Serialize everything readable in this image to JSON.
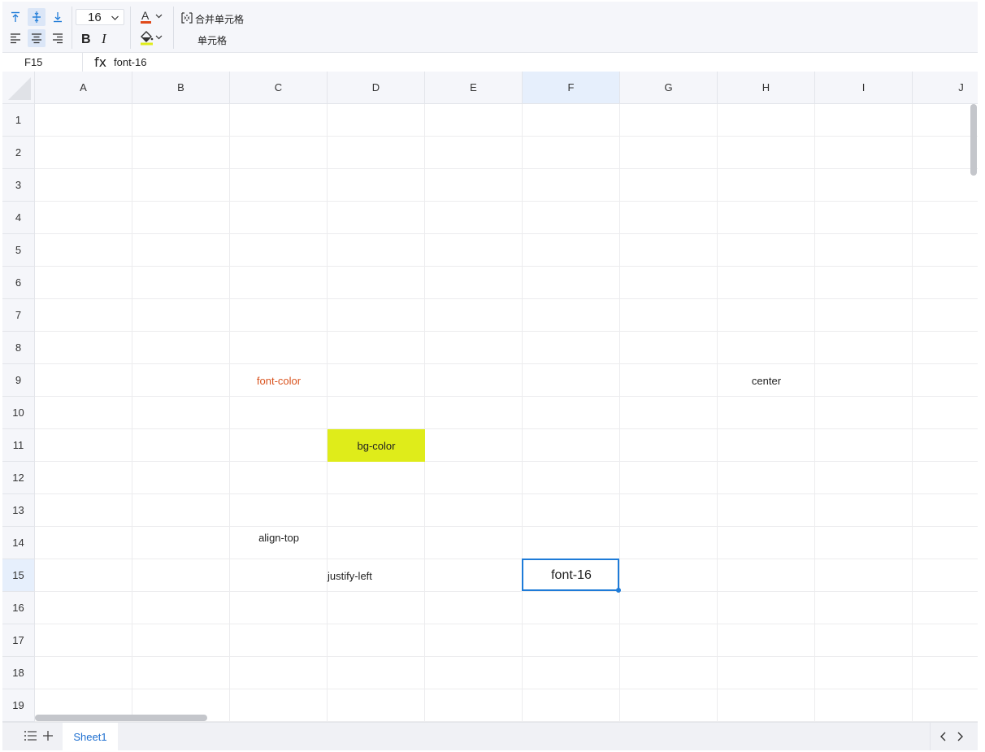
{
  "toolbar": {
    "font_size": "16",
    "merge_label": "合并单元格",
    "unmerge_label": "单元格",
    "icons": [
      "align-top-icon",
      "align-middle-icon",
      "align-bottom-icon",
      "align-left-icon",
      "align-center-icon",
      "align-right-icon",
      "bold-icon",
      "italic-icon",
      "font-color-icon",
      "fill-color-icon",
      "merge-cells-icon"
    ],
    "font_color": "#e04a1a",
    "fill_color": "#dfec1a"
  },
  "formula_bar": {
    "cell_ref": "F15",
    "fx": "fx",
    "value": "font-16"
  },
  "grid": {
    "columns": [
      "A",
      "B",
      "C",
      "D",
      "E",
      "F",
      "G",
      "H",
      "I",
      "J"
    ],
    "rows": [
      "1",
      "2",
      "3",
      "4",
      "5",
      "6",
      "7",
      "8",
      "9",
      "10",
      "11",
      "12",
      "13",
      "14",
      "15",
      "16",
      "17",
      "18",
      "19"
    ],
    "selected_column": "F",
    "selected_row": "15"
  },
  "cells": {
    "C9": {
      "text": "font-color",
      "color": "#d9531e"
    },
    "H9": {
      "text": "center"
    },
    "D11": {
      "text": "bg-color",
      "background": "#dfec1a"
    },
    "C14": {
      "text": "align-top"
    },
    "D15": {
      "text": "justify-left"
    },
    "F15": {
      "text": "font-16"
    }
  },
  "sheet_bar": {
    "tabs": [
      "Sheet1"
    ],
    "active_tab": "Sheet1"
  }
}
